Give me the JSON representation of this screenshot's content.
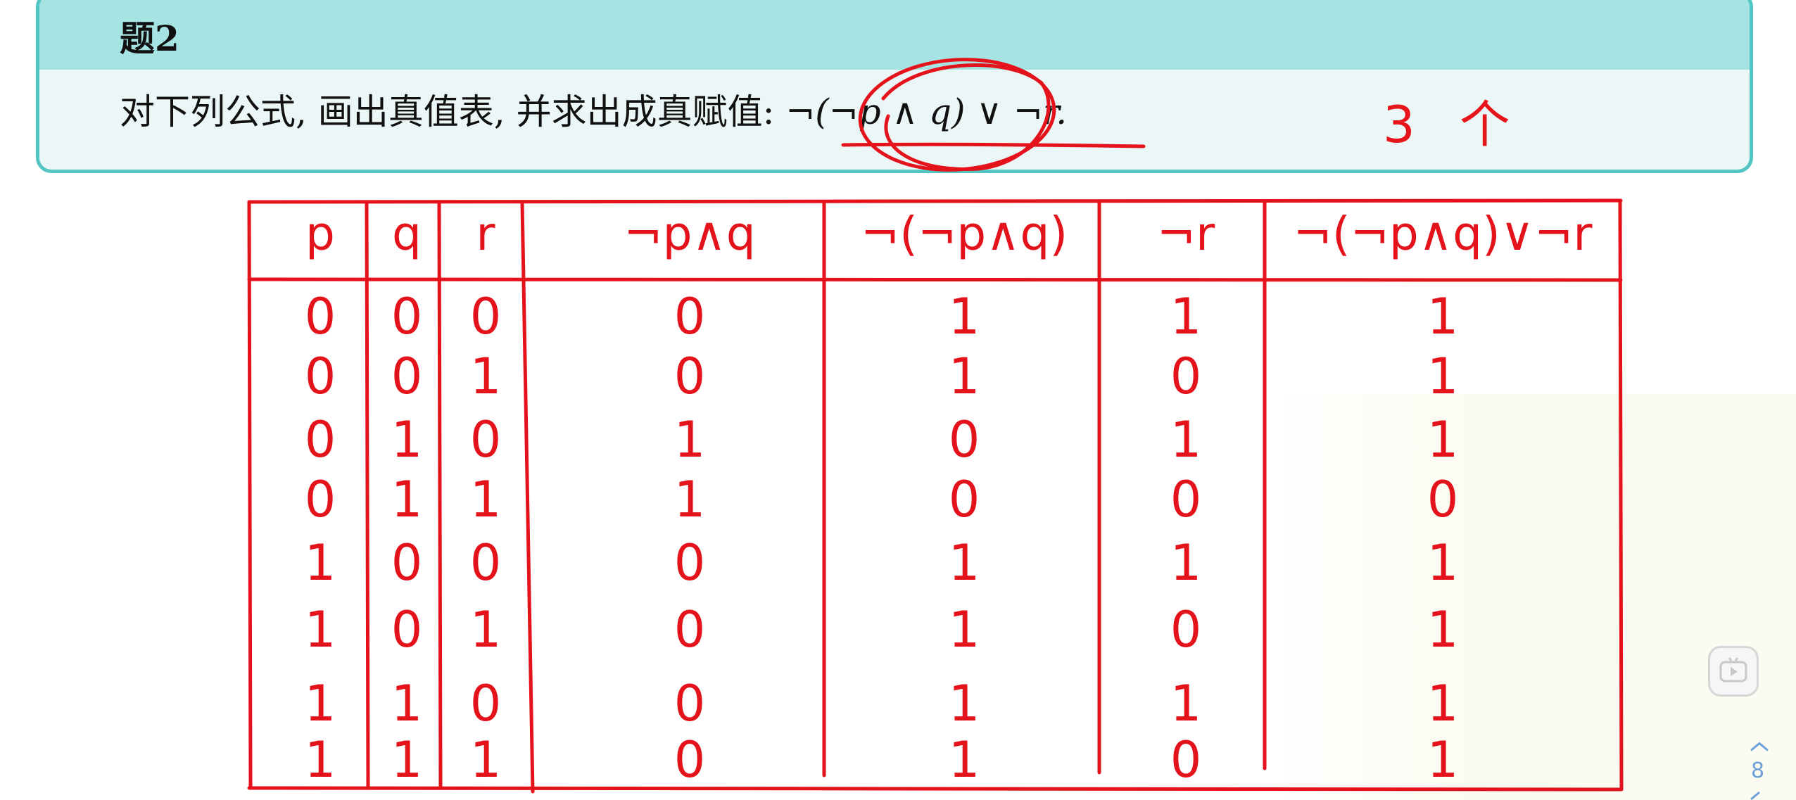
{
  "problem": {
    "title": "题2",
    "text": "对下列公式, 画出真值表, 并求出成真赋值:",
    "formula": "¬(¬p ∧ q) ∨ ¬r.",
    "answer_note": "3 个"
  },
  "truth_table": {
    "headers": [
      "p",
      "q",
      "r",
      "¬p∧q",
      "¬(¬p∧q)",
      "¬r",
      "¬(¬p∧q)∨¬r"
    ],
    "rows": [
      [
        "0",
        "0",
        "0",
        "0",
        "1",
        "1",
        "1"
      ],
      [
        "0",
        "0",
        "1",
        "0",
        "1",
        "0",
        "1"
      ],
      [
        "0",
        "1",
        "0",
        "1",
        "0",
        "1",
        "1"
      ],
      [
        "0",
        "1",
        "1",
        "1",
        "0",
        "0",
        "0"
      ],
      [
        "1",
        "0",
        "0",
        "0",
        "1",
        "1",
        "1"
      ],
      [
        "1",
        "0",
        "1",
        "0",
        "1",
        "0",
        "1"
      ],
      [
        "1",
        "1",
        "0",
        "0",
        "1",
        "1",
        "1"
      ],
      [
        "1",
        "1",
        "1",
        "0",
        "1",
        "0",
        "1"
      ]
    ]
  },
  "sidebar": {
    "page_number": "8"
  },
  "colors": {
    "ink": "#e3121b",
    "box_border": "#53c6c4",
    "box_header": "#a6e3e3",
    "box_body": "#ebf7f7"
  }
}
